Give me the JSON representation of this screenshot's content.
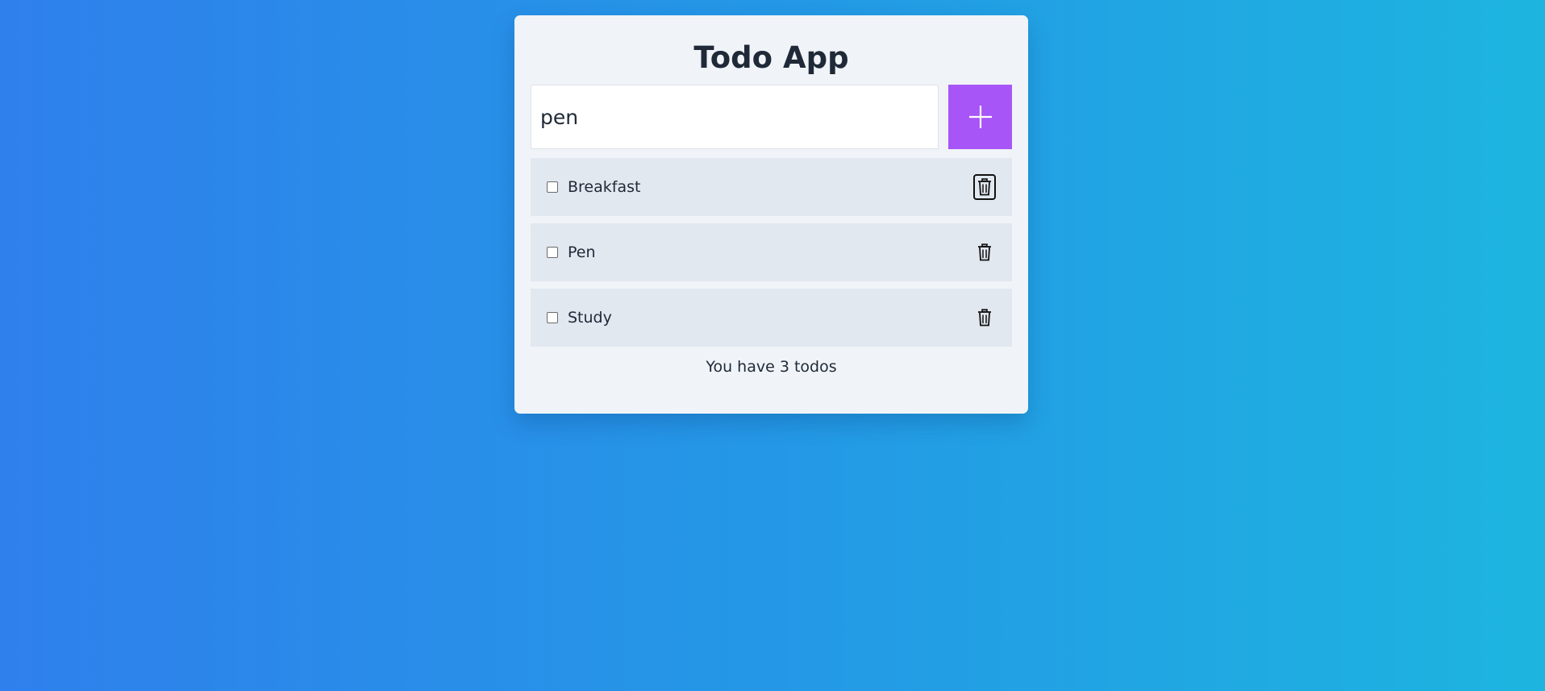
{
  "app": {
    "title": "Todo App"
  },
  "input": {
    "value": "pen",
    "placeholder": ""
  },
  "add_button": {
    "icon": "plus-icon"
  },
  "todos": [
    {
      "label": "Breakfast",
      "checked": false,
      "delete_icon": "trash-icon"
    },
    {
      "label": "Pen",
      "checked": false,
      "delete_icon": "trash-icon"
    },
    {
      "label": "Study",
      "checked": false,
      "delete_icon": "trash-icon"
    }
  ],
  "footer": {
    "text": "You have 3 todos"
  },
  "colors": {
    "accent": "#a855f7",
    "card_bg": "#f0f4f8",
    "item_bg": "#e2e8f0",
    "text": "#1f2937"
  }
}
